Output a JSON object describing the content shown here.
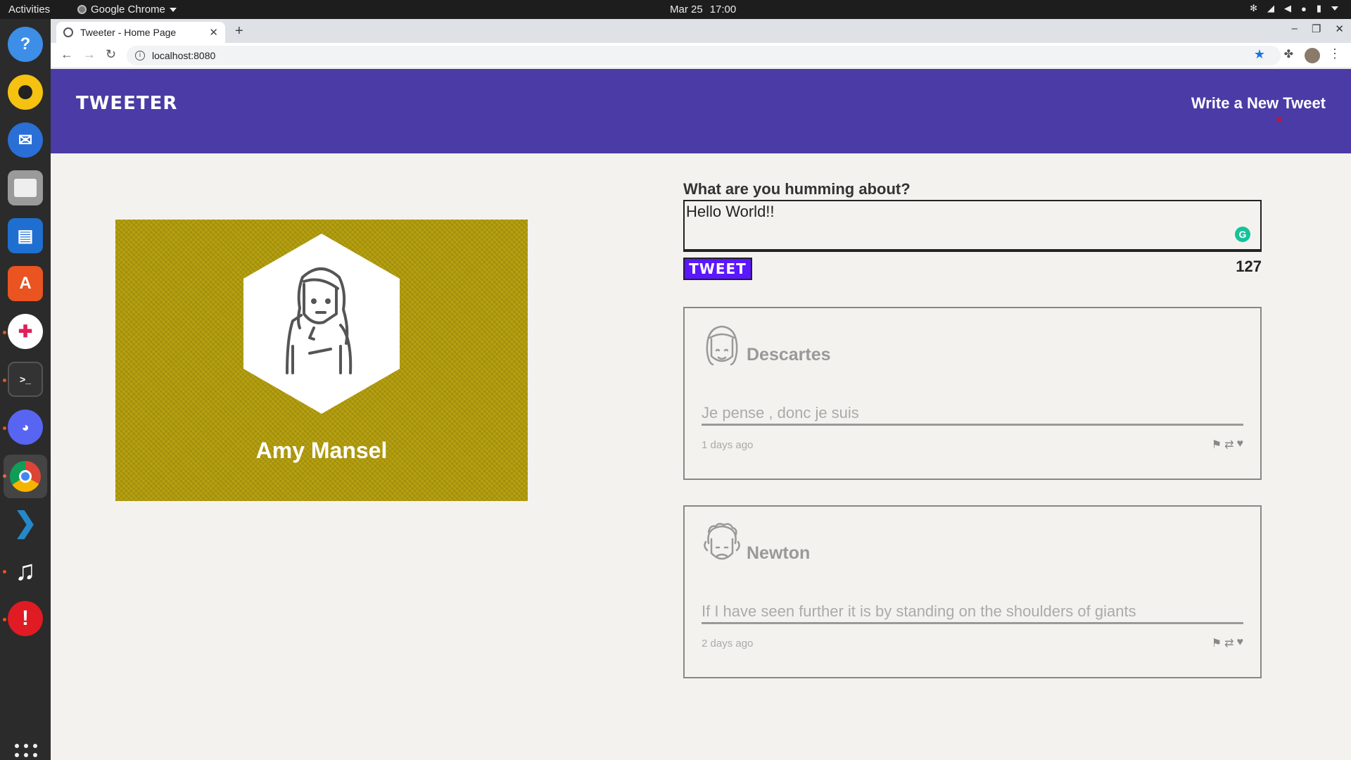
{
  "system": {
    "activities_label": "Activities",
    "app_name": "Google Chrome",
    "date": "Mar 25",
    "time": "17:00"
  },
  "dock": {
    "apps": [
      "help",
      "rhythmbox",
      "thunderbird",
      "files",
      "libreoffice-writer",
      "ubuntu-software",
      "slack",
      "terminal",
      "discord",
      "chrome",
      "vscode",
      "music",
      "update-notifier"
    ]
  },
  "browser": {
    "tab_title": "Tweeter - Home Page",
    "url": "localhost:8080"
  },
  "nav": {
    "brand": "TWEETER",
    "write_new": "Write a New Tweet",
    "write_arrow": "»"
  },
  "profile": {
    "name": "Amy Mansel"
  },
  "compose": {
    "label": "What are you humming about?",
    "value": "Hello World!!",
    "button_label": "TWEET",
    "counter": "127"
  },
  "tweets": [
    {
      "name": "Descartes",
      "content": "Je pense , donc je suis",
      "time": "1 days ago"
    },
    {
      "name": "Newton",
      "content": "If I have seen further it is by standing on the shoulders of giants",
      "time": "2 days ago"
    }
  ],
  "colors": {
    "nav_bg": "#4a3ba6",
    "profile_bg": "#b09a08",
    "tweet_button": "#5b17ff",
    "arrow": "#e0101a",
    "page_bg": "#f4f2ee"
  }
}
